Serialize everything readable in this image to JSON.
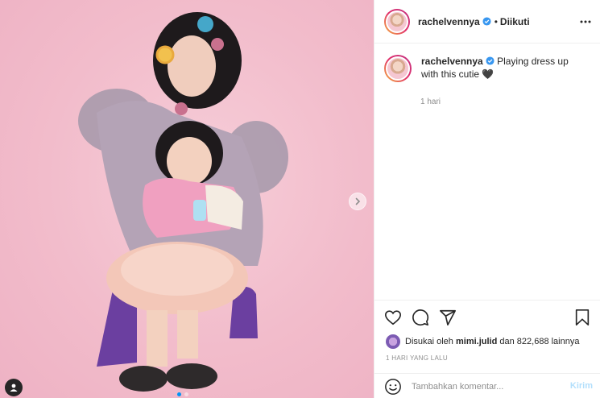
{
  "post": {
    "username": "rachelvennya",
    "follow_separator": "•",
    "follow_status": "Diikuti",
    "caption_text": "Playing dress up with this cutie 🖤",
    "caption_time": "1 hari",
    "likes_prefix": "Disukai oleh",
    "likes_user": "mimi.julid",
    "likes_suffix": "dan 822,688 lainnya",
    "posted_ago": "1 HARI YANG LALU"
  },
  "comment": {
    "placeholder": "Tambahkan komentar...",
    "send_label": "Kirim"
  },
  "icons": [
    "heart-icon",
    "comment-icon",
    "share-icon",
    "bookmark-icon",
    "more-icon",
    "emoji-icon",
    "chevron-right-icon",
    "user-tag-icon",
    "verified-icon"
  ],
  "colors": {
    "background_pink": "#f2bccb",
    "verified_blue": "#3897f0",
    "send_disabled": "#b2dffc",
    "muted_text": "#8e8e8e"
  },
  "carousel": {
    "slide_count": 2,
    "active_index": 0
  }
}
